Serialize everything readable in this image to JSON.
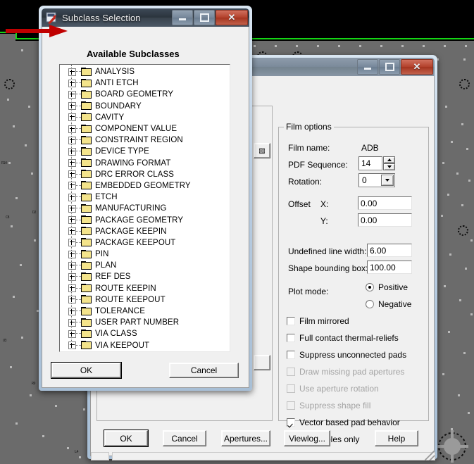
{
  "background": {
    "app_name": "pcb-cad-canvas",
    "board_outline_color": "#15d515",
    "plane_color": "#6b6b6b",
    "canvas_color": "#000000"
  },
  "annotation": {
    "arrow_color": "#c00000",
    "name": "red-pointer-arrow"
  },
  "main_dialog": {
    "title": "",
    "titlebar_buttons": {
      "minimize": "–",
      "maximize": "□",
      "close": "X"
    },
    "film_options": {
      "group_title": "Film options",
      "film_name_label": "Film name:",
      "film_name_value": "ADB",
      "pdf_sequence_label": "PDF Sequence:",
      "pdf_sequence_value": "14",
      "rotation_label": "Rotation:",
      "rotation_value": "0",
      "offset_label": "Offset",
      "offset_x_label": "X:",
      "offset_x_value": "0.00",
      "offset_y_label": "Y:",
      "offset_y_value": "0.00",
      "undefined_line_width_label": "Undefined line width:",
      "undefined_line_width_value": "6.00",
      "shape_bounding_box_label": "Shape bounding box:",
      "shape_bounding_box_value": "100.00",
      "plot_mode_label": "Plot mode:",
      "plot_mode_options": [
        {
          "label": "Positive",
          "selected": true
        },
        {
          "label": "Negative",
          "selected": false
        }
      ],
      "checkboxes": [
        {
          "label": "Film mirrored",
          "checked": false,
          "disabled": false
        },
        {
          "label": "Full contact thermal-reliefs",
          "checked": false,
          "disabled": false
        },
        {
          "label": "Suppress unconnected pads",
          "checked": false,
          "disabled": false
        },
        {
          "label": "Draw missing pad apertures",
          "checked": false,
          "disabled": true
        },
        {
          "label": "Use aperture rotation",
          "checked": false,
          "disabled": true
        },
        {
          "label": "Suppress shape fill",
          "checked": false,
          "disabled": true
        },
        {
          "label": "Vector based pad behavior",
          "checked": true,
          "disabled": false
        },
        {
          "label": "Draw holes only",
          "checked": false,
          "disabled": false
        }
      ]
    },
    "buttons": [
      {
        "label": "OK",
        "name": "ok-button",
        "default": true
      },
      {
        "label": "Cancel",
        "name": "cancel-button",
        "default": false
      },
      {
        "label": "Apertures...",
        "name": "apertures-button",
        "default": false
      },
      {
        "label": "Viewlog...",
        "name": "viewlog-button",
        "default": false
      },
      {
        "label": "Help",
        "name": "help-button",
        "default": false
      }
    ]
  },
  "subclass_dialog": {
    "title": "Subclass Selection",
    "icon": "app-icon",
    "titlebar_buttons": {
      "minimize": "–",
      "maximize": "□",
      "close": "X"
    },
    "heading": "Available Subclasses",
    "tree_items": [
      "ANALYSIS",
      "ANTI ETCH",
      "BOARD GEOMETRY",
      "BOUNDARY",
      "CAVITY",
      "COMPONENT VALUE",
      "CONSTRAINT REGION",
      "DEVICE TYPE",
      "DRAWING FORMAT",
      "DRC ERROR CLASS",
      "EMBEDDED GEOMETRY",
      "ETCH",
      "MANUFACTURING",
      "PACKAGE GEOMETRY",
      "PACKAGE KEEPIN",
      "PACKAGE KEEPOUT",
      "PIN",
      "PLAN",
      "REF DES",
      "ROUTE KEEPIN",
      "ROUTE KEEPOUT",
      "TOLERANCE",
      "USER PART NUMBER",
      "VIA CLASS",
      "VIA KEEPOUT"
    ],
    "buttons": [
      {
        "label": "OK",
        "name": "subclass-ok-button"
      },
      {
        "label": "Cancel",
        "name": "subclass-cancel-button"
      }
    ]
  }
}
